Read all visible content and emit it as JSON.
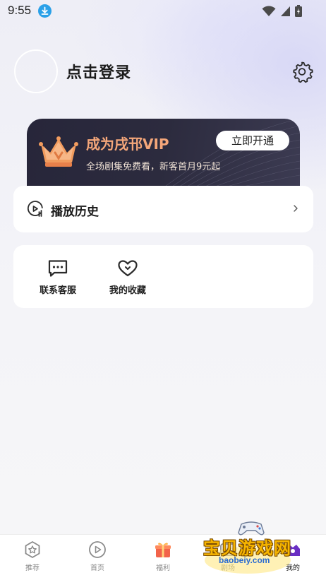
{
  "status_bar": {
    "time": "9:55"
  },
  "profile": {
    "login_label": "点击登录"
  },
  "vip": {
    "title": "成为戌邗VIP",
    "subtitle": "全场剧集免费看，新客首月9元起",
    "button_label": "立即开通"
  },
  "history": {
    "label": "播放历史"
  },
  "services": [
    {
      "label": "联系客服",
      "icon": "chat-icon"
    },
    {
      "label": "我的收藏",
      "icon": "heart-icon"
    }
  ],
  "bottom_nav": [
    {
      "label": "推荐",
      "icon": "star-hexagon-icon",
      "active": false
    },
    {
      "label": "首页",
      "icon": "play-circle-icon",
      "active": false
    },
    {
      "label": "福利",
      "icon": "gift-icon",
      "active": false
    },
    {
      "label": "剧场",
      "icon": "theater-icon",
      "active": false
    },
    {
      "label": "我的",
      "icon": "profile-icon",
      "active": true
    }
  ],
  "watermark": {
    "title": "宝贝游戏网",
    "url": "baobeiy.com"
  },
  "colors": {
    "vip_title": "#f5a77a",
    "vip_card": "#2a2a3c",
    "download_badge": "#2aa0e8"
  }
}
